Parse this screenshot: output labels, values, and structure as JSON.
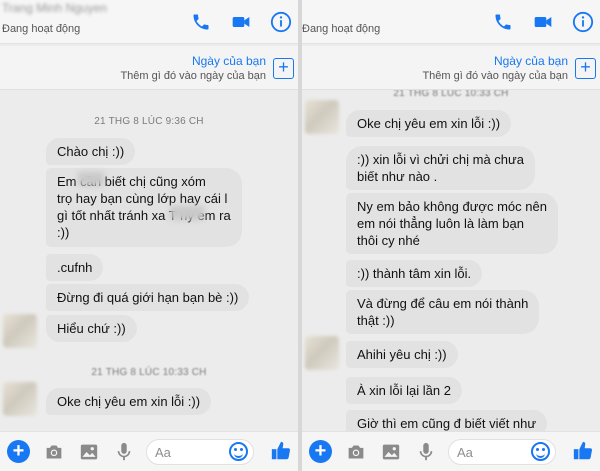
{
  "colors": {
    "accent": "#1877f2",
    "bubble": "#e2e2e2",
    "background": "#ececec"
  },
  "header": {
    "contact_name_blurred": "Trang Minh Nguyen",
    "status": "Đang hoạt động",
    "icons": [
      "phone-icon",
      "video-camera-icon",
      "info-icon"
    ]
  },
  "day_banner": {
    "title": "Ngày của bạn",
    "subtitle": "Thêm gì đó vào ngày của bạn",
    "icon": "plus-square-icon"
  },
  "composer": {
    "placeholder": "Aa",
    "icons": [
      "plus-icon",
      "camera-icon",
      "image-icon",
      "mic-icon",
      "emoji-icon",
      "thumbs-up-icon"
    ]
  },
  "left_chat": {
    "timestamp1": "21 THG 8 LÚC 9:36 CH",
    "timestamp2": "21 THG 8 LÚC 10:33 CH",
    "messages": [
      {
        "text": "Chào chị :))"
      },
      {
        "line1": "Em        cần biết chị cũng xóm",
        "line2": "trọ hay bạn cùng lớp hay cái l",
        "line3": "gì tốt nhất tránh xa T        ny em ra",
        "line4": ":))"
      },
      {
        "text": ".cufnh"
      },
      {
        "text": "Đừng đi quá giới hạn bạn bè :))"
      },
      {
        "text": "Hiểu chứ :))"
      },
      {
        "text": "Oke chị yêu em xin lỗi :))"
      }
    ]
  },
  "right_chat": {
    "timestamp_top": "21 THG 8 LÚC 10:33 CH",
    "messages": [
      {
        "text": "Oke chị yêu em xin lỗi :))"
      },
      {
        "line1": ":)) xin lỗi vì chửi chị mà chưa",
        "line2": "biết như nào ."
      },
      {
        "line1": "Ny em bảo không được móc nên",
        "line2": "em nói thẳng luôn là làm bạn",
        "line3": "thôi cy nhé"
      },
      {
        "text": ":)) thành tâm xin lỗi."
      },
      {
        "line1": "Và đừng để câu em nói thành",
        "line2": "thật :))"
      },
      {
        "text": "Ahihi yêu chị :))"
      },
      {
        "text": "À xin lỗi lại lần 2"
      },
      {
        "text": "Giờ thì em cũng đ biết viết như"
      }
    ]
  }
}
